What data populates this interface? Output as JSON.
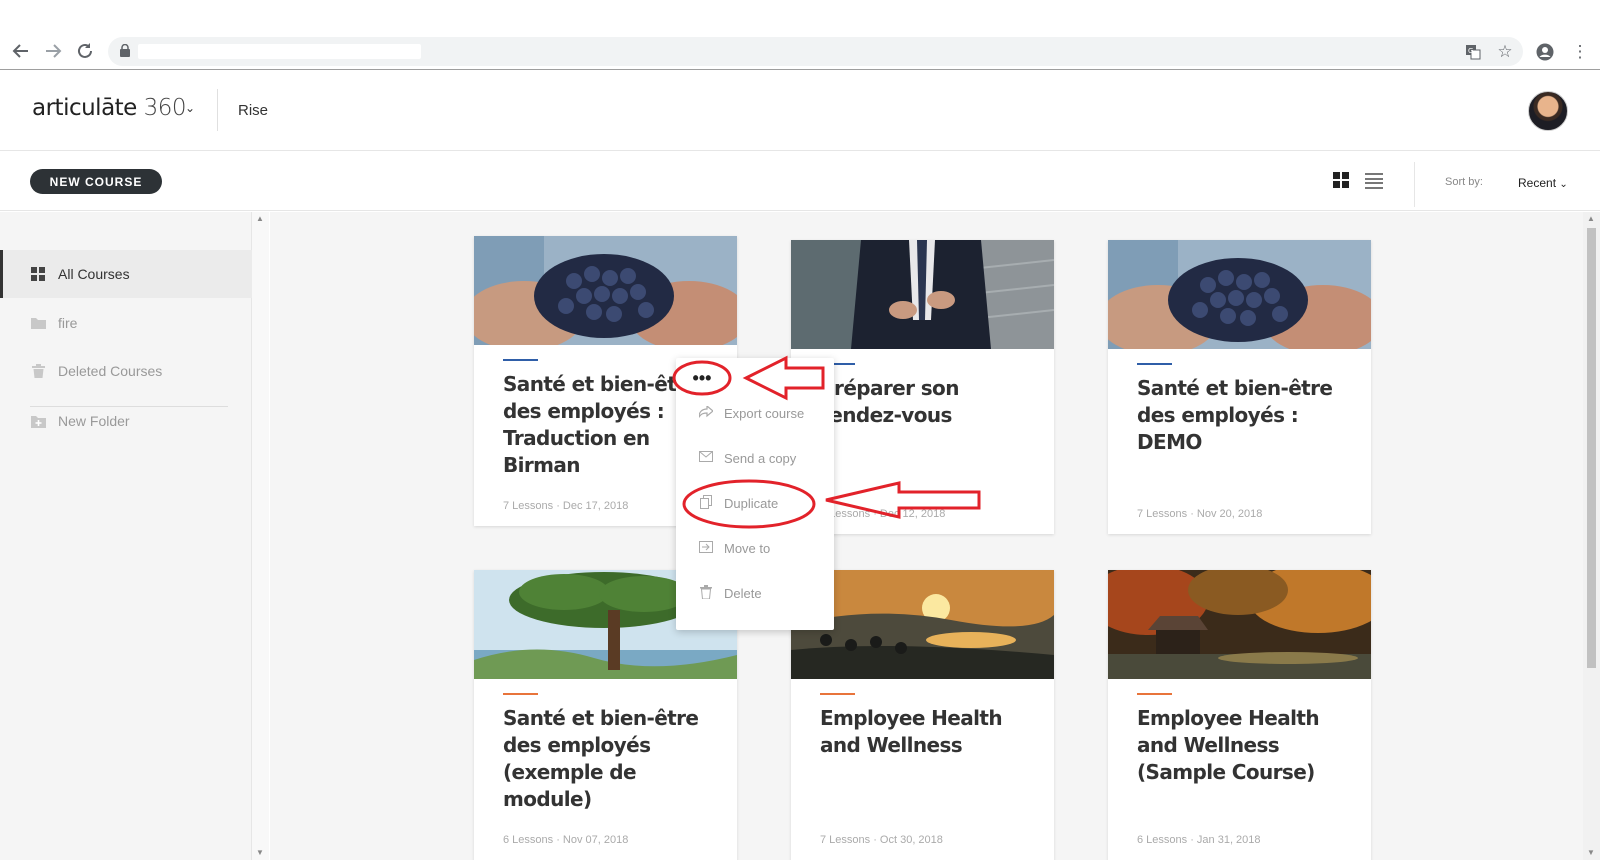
{
  "browser": {
    "back_icon": "arrow-left-icon",
    "forward_icon": "arrow-right-icon",
    "reload_icon": "reload-icon"
  },
  "header": {
    "logo_word": "articulāte",
    "logo_num": "360",
    "app_name": "Rise"
  },
  "toolbar": {
    "new_course": "NEW COURSE",
    "sort_label": "Sort by:",
    "sort_value": "Recent"
  },
  "sidebar": {
    "items": [
      {
        "label": "All Courses"
      },
      {
        "label": "fire"
      },
      {
        "label": "Deleted Courses"
      },
      {
        "label": "New Folder"
      }
    ]
  },
  "courses": [
    {
      "title": "Santé et bien-être des employés : Traduction en Birman",
      "meta": "7 Lessons · Dec 17, 2018"
    },
    {
      "title": "Préparer son rendez-vous",
      "meta": "7 Lessons · Dec 12, 2018"
    },
    {
      "title": "Santé et bien-être des employés : DEMO",
      "meta": "7 Lessons · Nov 20, 2018"
    },
    {
      "title": "Santé et bien-être des employés (exemple de module)",
      "meta": "6 Lessons · Nov 07, 2018"
    },
    {
      "title": "Employee Health and Wellness",
      "meta": "7 Lessons · Oct 30, 2018"
    },
    {
      "title": "Employee Health and Wellness (Sample Course)",
      "meta": "6 Lessons · Jan 31, 2018"
    }
  ],
  "context_menu": {
    "trigger": "•••",
    "items": [
      {
        "label": "Export course",
        "icon": "share-icon"
      },
      {
        "label": "Send a copy",
        "icon": "envelope-icon"
      },
      {
        "label": "Duplicate",
        "icon": "copy-icon"
      },
      {
        "label": "Move to",
        "icon": "move-icon"
      },
      {
        "label": "Delete",
        "icon": "trash-icon"
      }
    ]
  },
  "colors": {
    "accent_blue": "#2f5ea8",
    "accent_orange": "#e8743b",
    "annotation_red": "#e2222a",
    "button_dark": "#2d3236"
  }
}
